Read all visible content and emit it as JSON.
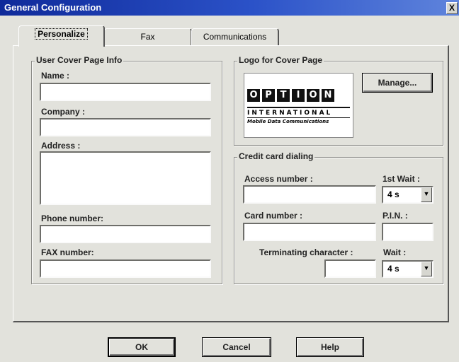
{
  "window": {
    "title": "General Configuration",
    "close_glyph": "X"
  },
  "tabs": [
    {
      "label": "Personalize",
      "active": true
    },
    {
      "label": "Fax",
      "active": false
    },
    {
      "label": "Communications",
      "active": false
    }
  ],
  "user_info": {
    "legend": "User Cover Page Info",
    "name_label": "Name :",
    "company_label": "Company :",
    "address_label": "Address :",
    "phone_label": "Phone number:",
    "fax_label": "FAX number:",
    "name_value": "",
    "company_value": "",
    "address_value": "",
    "phone_value": "",
    "fax_value": ""
  },
  "logo": {
    "legend": "Logo for Cover Page",
    "manage_label": "Manage...",
    "image_letters": [
      "O",
      "P",
      "T",
      "I",
      "O",
      "N"
    ],
    "image_line1": "INTERNATIONAL",
    "image_line2": "Mobile Data Communications"
  },
  "credit": {
    "legend": "Credit card dialing",
    "access_label": "Access number :",
    "first_wait_label": "1st Wait :",
    "first_wait_value": "4 s",
    "card_label": "Card number :",
    "pin_label": "P.I.N. :",
    "term_label": "Terminating character :",
    "wait_label": "Wait :",
    "wait_value": "4 s"
  },
  "buttons": {
    "ok": "OK",
    "cancel": "Cancel",
    "help": "Help"
  },
  "icons": {
    "close": "close-icon",
    "dropdown": "chevron-down-icon"
  }
}
